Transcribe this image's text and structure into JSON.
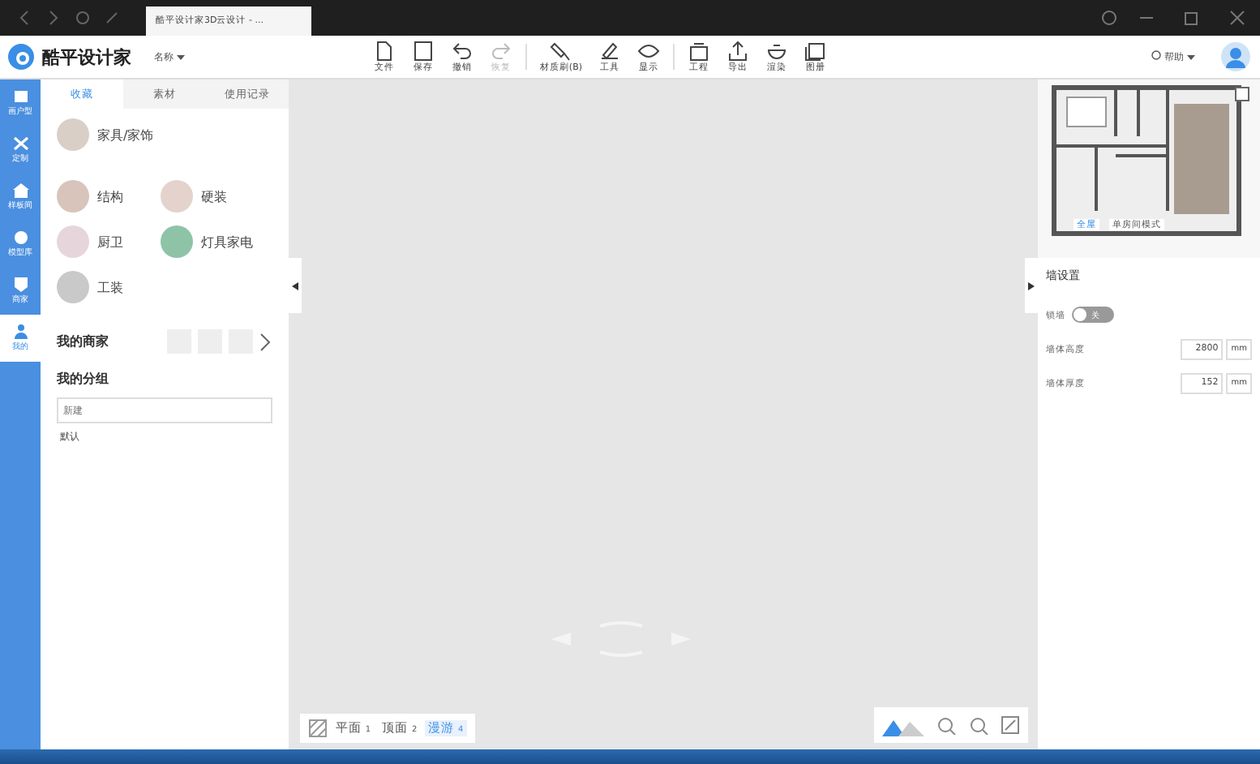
{
  "browser": {
    "tab_title": "酷平设计家3D云设计 - ..."
  },
  "header": {
    "logo": "酷平设计家",
    "project_name": "名称",
    "help": "帮助"
  },
  "toolbar": [
    {
      "label": "文件",
      "kind": "file",
      "disabled": false
    },
    {
      "label": "保存",
      "kind": "save",
      "disabled": false
    },
    {
      "label": "撤销",
      "kind": "undo",
      "disabled": false
    },
    {
      "label": "恢复",
      "kind": "redo",
      "disabled": true
    },
    {
      "label": "材质刷(B)",
      "kind": "brush",
      "disabled": false
    },
    {
      "label": "工具",
      "kind": "tool",
      "disabled": false
    },
    {
      "label": "显示",
      "kind": "eye",
      "disabled": false
    },
    {
      "label": "工程",
      "kind": "project",
      "disabled": false
    },
    {
      "label": "导出",
      "kind": "export",
      "disabled": false
    },
    {
      "label": "渲染",
      "kind": "render",
      "disabled": false
    },
    {
      "label": "图册",
      "kind": "album",
      "disabled": false
    }
  ],
  "sidebar": {
    "items": [
      {
        "label": "画户型",
        "kind": "plan",
        "selected": false
      },
      {
        "label": "定制",
        "kind": "custom",
        "selected": false
      },
      {
        "label": "样板间",
        "kind": "home",
        "selected": false
      },
      {
        "label": "模型库",
        "kind": "model",
        "selected": false
      },
      {
        "label": "商家",
        "kind": "shop",
        "selected": false
      },
      {
        "label": "我的",
        "kind": "user",
        "selected": true
      }
    ]
  },
  "panel": {
    "tabs": [
      {
        "label": "收藏",
        "selected": true
      },
      {
        "label": "素材",
        "selected": false
      },
      {
        "label": "使用记录",
        "selected": false
      }
    ],
    "categories": [
      {
        "label": "家具/家饰",
        "color": "#d9cfc6"
      },
      {
        "label": "结构",
        "color": "#d8c4bb"
      },
      {
        "label": "硬装",
        "color": "#e3d3cc"
      },
      {
        "label": "厨卫",
        "color": "#e6d6dc"
      },
      {
        "label": "灯具家电",
        "color": "#8fc3a8"
      },
      {
        "label": "工装",
        "color": "#c9c9c9"
      }
    ],
    "my_shops": "我的商家",
    "my_groups": "我的分组",
    "group_input": {
      "placeholder": "新建"
    },
    "groups": [
      "默认"
    ]
  },
  "view_bar": {
    "views": [
      {
        "label": "平面",
        "key": "1",
        "selected": false
      },
      {
        "label": "顶面",
        "key": "2",
        "selected": false
      },
      {
        "label": "漫游",
        "key": "4",
        "selected": true
      }
    ]
  },
  "minimap": {
    "mode_button": "单房间模式",
    "chip": "全屋"
  },
  "wall_settings": {
    "title": "墙设置",
    "lock": {
      "label": "锁墙",
      "on": false,
      "text": "关"
    },
    "fields": [
      {
        "label": "墙体高度",
        "value": "2800",
        "unit": "mm"
      },
      {
        "label": "墙体厚度",
        "value": "152",
        "unit": "mm"
      }
    ]
  }
}
